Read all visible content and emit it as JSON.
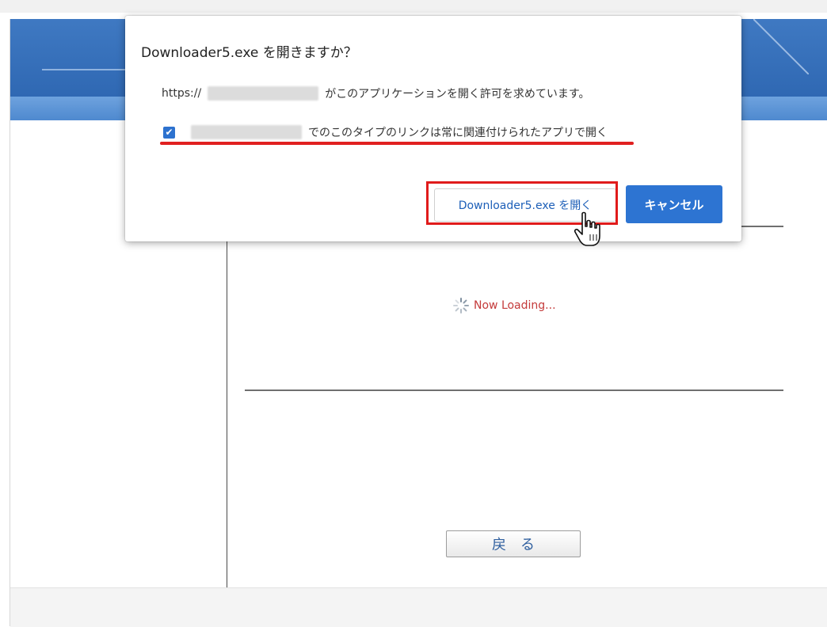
{
  "dialog": {
    "title": "Downloader5.exe を開きますか？",
    "message_prefix": "https://",
    "message_suffix": "がこのアプリケーションを開く許可を求めています。",
    "checkbox_checked": true,
    "checkbox_label": "でのこのタイプのリンクは常に関連付けられたアプリで開く",
    "open_button": "Downloader5.exe を開く",
    "cancel_button": "キャンセル"
  },
  "page": {
    "loading_text": "Now Loading...",
    "back_button": "戻る"
  },
  "colors": {
    "header_blue": "#2f68b3",
    "accent_red": "#e01b1b",
    "primary_button": "#2d74d2",
    "loading_text": "#c43a3a"
  },
  "icons": {
    "cursor": "hand-pointer-icon",
    "spinner": "spinner-icon",
    "checkbox": "checkbox-checked-icon"
  }
}
